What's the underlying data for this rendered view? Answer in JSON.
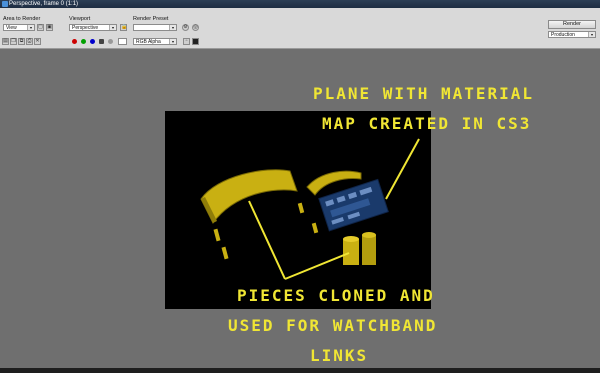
{
  "window": {
    "title": "Perspective, frame 0 (1:1)"
  },
  "toolbar": {
    "area_to_render_label": "Area to Render",
    "area_to_render_value": "View",
    "viewport_label": "Viewport",
    "viewport_value": "Perspective",
    "render_preset_label": "Render Preset",
    "render_preset_value": "",
    "render_button": "Render",
    "production_value": "Production",
    "channel_value": "RGB Alpha",
    "channel_colors": [
      "#cc0000",
      "#00a000",
      "#0000cc"
    ]
  },
  "annotations": {
    "plane_line1": "PLANE WITH MATERIAL",
    "plane_line2": "MAP CREATED IN CS3",
    "pieces_line1": "PIECES CLONED AND",
    "pieces_line2": "USED FOR WATCHBAND",
    "pieces_line3": "LINKS"
  },
  "colors": {
    "annotation": "#f0e634",
    "viewport_bg": "#000000",
    "frame_bg": "#6f6f6f"
  }
}
